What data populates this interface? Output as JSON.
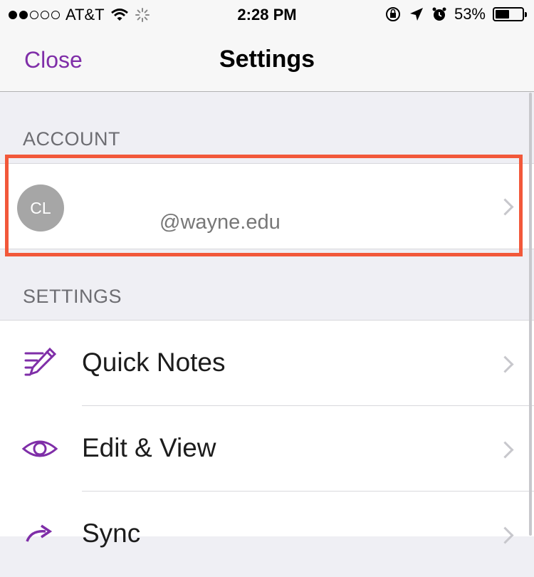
{
  "status_bar": {
    "carrier": "AT&T",
    "time": "2:28 PM",
    "battery_percent": "53%",
    "battery_level": 0.53,
    "signal_bars_filled": 2,
    "signal_bars_total": 5
  },
  "nav": {
    "close_label": "Close",
    "title": "Settings"
  },
  "account_section": {
    "header": "ACCOUNT",
    "avatar_initials": "CL",
    "email": "@wayne.edu"
  },
  "settings_section": {
    "header": "SETTINGS",
    "items": [
      {
        "label": "Quick Notes",
        "icon": "pencil-lines-icon"
      },
      {
        "label": "Edit & View",
        "icon": "eye-icon"
      },
      {
        "label": "Sync",
        "icon": "sync-arrow-icon"
      }
    ]
  },
  "colors": {
    "accent": "#7f2ea8",
    "highlight": "#f2583a"
  }
}
